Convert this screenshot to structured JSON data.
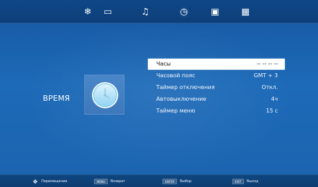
{
  "top_menu": {
    "icons": [
      {
        "name": "picture-icon",
        "glyph": "❄"
      },
      {
        "name": "monitor-icon",
        "glyph": "▭"
      },
      {
        "name": "music-icon",
        "glyph": "♫"
      },
      {
        "name": "clock-icon",
        "glyph": "◷"
      },
      {
        "name": "lock-icon",
        "glyph": "▣"
      },
      {
        "name": "apps-icon",
        "glyph": "▦"
      }
    ],
    "active_icon": "clock-icon"
  },
  "main": {
    "title": "ВРЕМЯ",
    "menu": [
      {
        "label": "Часы",
        "value": "-- -- -- --",
        "selected": true
      },
      {
        "label": "Часовой пояс",
        "value": "GMT + 3",
        "selected": false
      },
      {
        "label": "Таймер отключения",
        "value": "Откл.",
        "selected": false
      },
      {
        "label": "Автовыключение",
        "value": "4ч",
        "selected": false
      },
      {
        "label": "Таймер меню",
        "value": "15 с",
        "selected": false
      }
    ]
  },
  "footer": {
    "hints": [
      {
        "key": "",
        "label": "Перемещение",
        "icon": "move-icon"
      },
      {
        "key": "MENU",
        "label": "Возврат"
      },
      {
        "key": "ENTER",
        "label": "Выбор"
      },
      {
        "key": "EXIT",
        "label": "Выход"
      }
    ]
  },
  "colors": {
    "background": "#1f66b2",
    "top_bar": "#0f4787",
    "bottom_bar": "#0f467f",
    "selection": "#ffffff",
    "text": "#ffffff"
  }
}
